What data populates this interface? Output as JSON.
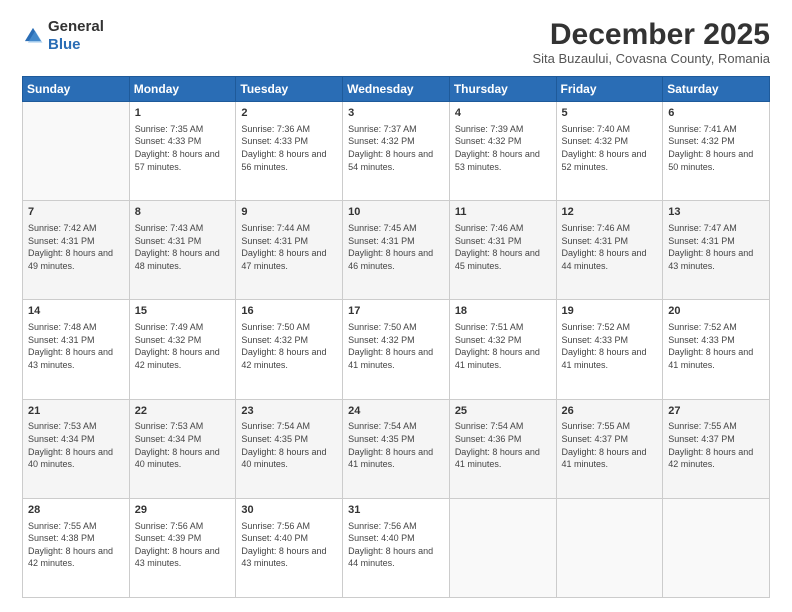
{
  "header": {
    "logo_general": "General",
    "logo_blue": "Blue",
    "month_title": "December 2025",
    "subtitle": "Sita Buzaului, Covasna County, Romania"
  },
  "weekdays": [
    "Sunday",
    "Monday",
    "Tuesday",
    "Wednesday",
    "Thursday",
    "Friday",
    "Saturday"
  ],
  "weeks": [
    [
      {
        "day": "",
        "sunrise": "",
        "sunset": "",
        "daylight": "",
        "empty": true
      },
      {
        "day": "1",
        "sunrise": "Sunrise: 7:35 AM",
        "sunset": "Sunset: 4:33 PM",
        "daylight": "Daylight: 8 hours and 57 minutes.",
        "empty": false
      },
      {
        "day": "2",
        "sunrise": "Sunrise: 7:36 AM",
        "sunset": "Sunset: 4:33 PM",
        "daylight": "Daylight: 8 hours and 56 minutes.",
        "empty": false
      },
      {
        "day": "3",
        "sunrise": "Sunrise: 7:37 AM",
        "sunset": "Sunset: 4:32 PM",
        "daylight": "Daylight: 8 hours and 54 minutes.",
        "empty": false
      },
      {
        "day": "4",
        "sunrise": "Sunrise: 7:39 AM",
        "sunset": "Sunset: 4:32 PM",
        "daylight": "Daylight: 8 hours and 53 minutes.",
        "empty": false
      },
      {
        "day": "5",
        "sunrise": "Sunrise: 7:40 AM",
        "sunset": "Sunset: 4:32 PM",
        "daylight": "Daylight: 8 hours and 52 minutes.",
        "empty": false
      },
      {
        "day": "6",
        "sunrise": "Sunrise: 7:41 AM",
        "sunset": "Sunset: 4:32 PM",
        "daylight": "Daylight: 8 hours and 50 minutes.",
        "empty": false
      }
    ],
    [
      {
        "day": "7",
        "sunrise": "Sunrise: 7:42 AM",
        "sunset": "Sunset: 4:31 PM",
        "daylight": "Daylight: 8 hours and 49 minutes.",
        "empty": false
      },
      {
        "day": "8",
        "sunrise": "Sunrise: 7:43 AM",
        "sunset": "Sunset: 4:31 PM",
        "daylight": "Daylight: 8 hours and 48 minutes.",
        "empty": false
      },
      {
        "day": "9",
        "sunrise": "Sunrise: 7:44 AM",
        "sunset": "Sunset: 4:31 PM",
        "daylight": "Daylight: 8 hours and 47 minutes.",
        "empty": false
      },
      {
        "day": "10",
        "sunrise": "Sunrise: 7:45 AM",
        "sunset": "Sunset: 4:31 PM",
        "daylight": "Daylight: 8 hours and 46 minutes.",
        "empty": false
      },
      {
        "day": "11",
        "sunrise": "Sunrise: 7:46 AM",
        "sunset": "Sunset: 4:31 PM",
        "daylight": "Daylight: 8 hours and 45 minutes.",
        "empty": false
      },
      {
        "day": "12",
        "sunrise": "Sunrise: 7:46 AM",
        "sunset": "Sunset: 4:31 PM",
        "daylight": "Daylight: 8 hours and 44 minutes.",
        "empty": false
      },
      {
        "day": "13",
        "sunrise": "Sunrise: 7:47 AM",
        "sunset": "Sunset: 4:31 PM",
        "daylight": "Daylight: 8 hours and 43 minutes.",
        "empty": false
      }
    ],
    [
      {
        "day": "14",
        "sunrise": "Sunrise: 7:48 AM",
        "sunset": "Sunset: 4:31 PM",
        "daylight": "Daylight: 8 hours and 43 minutes.",
        "empty": false
      },
      {
        "day": "15",
        "sunrise": "Sunrise: 7:49 AM",
        "sunset": "Sunset: 4:32 PM",
        "daylight": "Daylight: 8 hours and 42 minutes.",
        "empty": false
      },
      {
        "day": "16",
        "sunrise": "Sunrise: 7:50 AM",
        "sunset": "Sunset: 4:32 PM",
        "daylight": "Daylight: 8 hours and 42 minutes.",
        "empty": false
      },
      {
        "day": "17",
        "sunrise": "Sunrise: 7:50 AM",
        "sunset": "Sunset: 4:32 PM",
        "daylight": "Daylight: 8 hours and 41 minutes.",
        "empty": false
      },
      {
        "day": "18",
        "sunrise": "Sunrise: 7:51 AM",
        "sunset": "Sunset: 4:32 PM",
        "daylight": "Daylight: 8 hours and 41 minutes.",
        "empty": false
      },
      {
        "day": "19",
        "sunrise": "Sunrise: 7:52 AM",
        "sunset": "Sunset: 4:33 PM",
        "daylight": "Daylight: 8 hours and 41 minutes.",
        "empty": false
      },
      {
        "day": "20",
        "sunrise": "Sunrise: 7:52 AM",
        "sunset": "Sunset: 4:33 PM",
        "daylight": "Daylight: 8 hours and 41 minutes.",
        "empty": false
      }
    ],
    [
      {
        "day": "21",
        "sunrise": "Sunrise: 7:53 AM",
        "sunset": "Sunset: 4:34 PM",
        "daylight": "Daylight: 8 hours and 40 minutes.",
        "empty": false
      },
      {
        "day": "22",
        "sunrise": "Sunrise: 7:53 AM",
        "sunset": "Sunset: 4:34 PM",
        "daylight": "Daylight: 8 hours and 40 minutes.",
        "empty": false
      },
      {
        "day": "23",
        "sunrise": "Sunrise: 7:54 AM",
        "sunset": "Sunset: 4:35 PM",
        "daylight": "Daylight: 8 hours and 40 minutes.",
        "empty": false
      },
      {
        "day": "24",
        "sunrise": "Sunrise: 7:54 AM",
        "sunset": "Sunset: 4:35 PM",
        "daylight": "Daylight: 8 hours and 41 minutes.",
        "empty": false
      },
      {
        "day": "25",
        "sunrise": "Sunrise: 7:54 AM",
        "sunset": "Sunset: 4:36 PM",
        "daylight": "Daylight: 8 hours and 41 minutes.",
        "empty": false
      },
      {
        "day": "26",
        "sunrise": "Sunrise: 7:55 AM",
        "sunset": "Sunset: 4:37 PM",
        "daylight": "Daylight: 8 hours and 41 minutes.",
        "empty": false
      },
      {
        "day": "27",
        "sunrise": "Sunrise: 7:55 AM",
        "sunset": "Sunset: 4:37 PM",
        "daylight": "Daylight: 8 hours and 42 minutes.",
        "empty": false
      }
    ],
    [
      {
        "day": "28",
        "sunrise": "Sunrise: 7:55 AM",
        "sunset": "Sunset: 4:38 PM",
        "daylight": "Daylight: 8 hours and 42 minutes.",
        "empty": false
      },
      {
        "day": "29",
        "sunrise": "Sunrise: 7:56 AM",
        "sunset": "Sunset: 4:39 PM",
        "daylight": "Daylight: 8 hours and 43 minutes.",
        "empty": false
      },
      {
        "day": "30",
        "sunrise": "Sunrise: 7:56 AM",
        "sunset": "Sunset: 4:40 PM",
        "daylight": "Daylight: 8 hours and 43 minutes.",
        "empty": false
      },
      {
        "day": "31",
        "sunrise": "Sunrise: 7:56 AM",
        "sunset": "Sunset: 4:40 PM",
        "daylight": "Daylight: 8 hours and 44 minutes.",
        "empty": false
      },
      {
        "day": "",
        "sunrise": "",
        "sunset": "",
        "daylight": "",
        "empty": true
      },
      {
        "day": "",
        "sunrise": "",
        "sunset": "",
        "daylight": "",
        "empty": true
      },
      {
        "day": "",
        "sunrise": "",
        "sunset": "",
        "daylight": "",
        "empty": true
      }
    ]
  ]
}
